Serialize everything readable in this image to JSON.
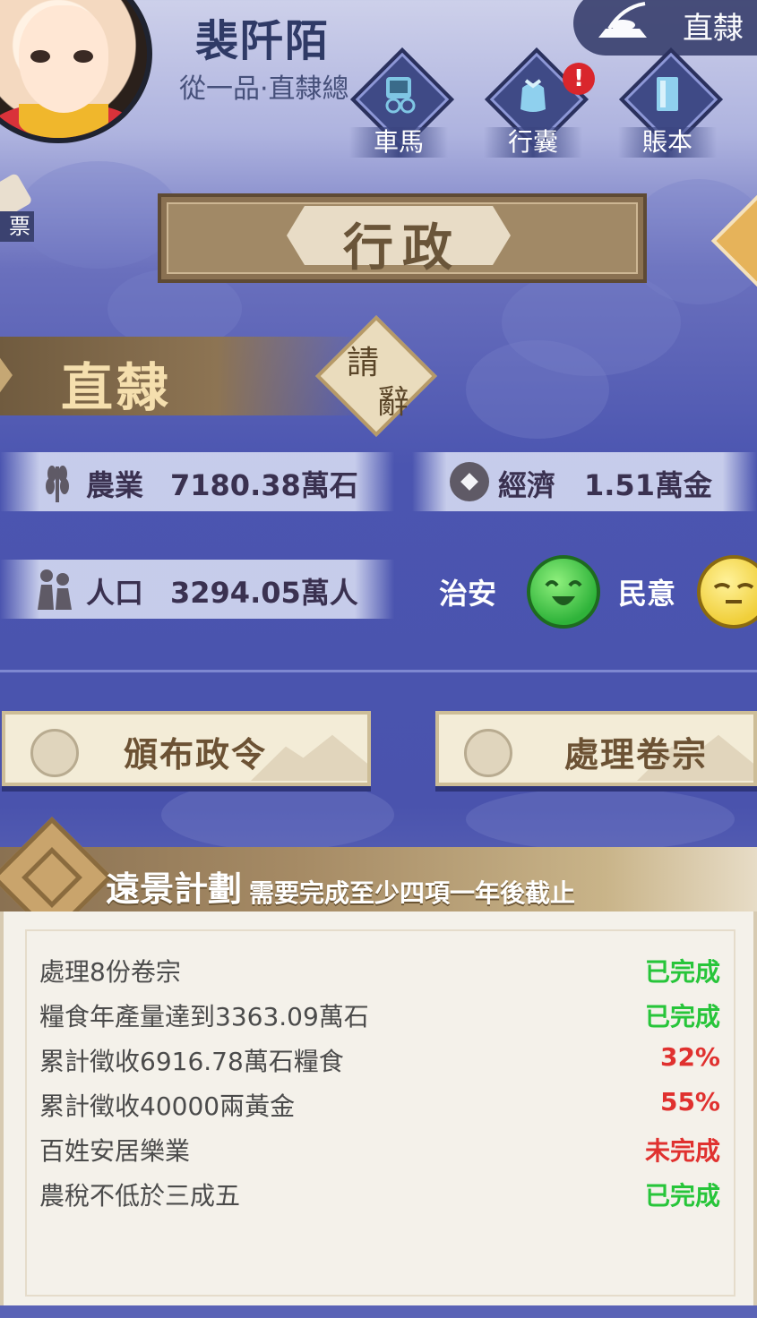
{
  "player": {
    "name": "裴阡陌",
    "title": "從一品·直隸總"
  },
  "region_button": {
    "label": "直隸",
    "icon": "carriage-seal-icon"
  },
  "menu": [
    {
      "label": "車馬",
      "icon": "carriage-icon",
      "badge": ""
    },
    {
      "label": "行囊",
      "icon": "bundle-icon",
      "badge": "!"
    },
    {
      "label": "賬本",
      "icon": "ledger-icon",
      "badge": ""
    }
  ],
  "side_tab": {
    "label": "票"
  },
  "page": {
    "title": "行政"
  },
  "region": {
    "name": "直隸",
    "resign_line1": "請",
    "resign_line2": "辭"
  },
  "stats": {
    "agriculture": {
      "label": "農業",
      "value": "7180.38萬石",
      "icon": "wheat-icon"
    },
    "economy": {
      "label": "經濟",
      "value": "1.51萬金",
      "icon": "coin-icon"
    },
    "population": {
      "label": "人口",
      "value": "3294.05萬人",
      "icon": "people-icon"
    },
    "security": {
      "label": "治安",
      "face": "happy-face-icon"
    },
    "public_opinion": {
      "label": "民意",
      "face": "neutral-face-icon"
    }
  },
  "actions": {
    "issue_decree": "頒布政令",
    "process_files": "處理卷宗"
  },
  "plan": {
    "title": "遠景計劃",
    "note": "需要完成至少四項一年後截止",
    "tasks": [
      {
        "name": "處理8份卷宗",
        "status": "已完成",
        "state": "ok"
      },
      {
        "name": "糧食年產量達到3363.09萬石",
        "status": "已完成",
        "state": "ok"
      },
      {
        "name": "累計徵收6916.78萬石糧食",
        "status": "32%",
        "state": "bad"
      },
      {
        "name": "累計徵收40000兩黃金",
        "status": "55%",
        "state": "bad"
      },
      {
        "name": "百姓安居樂業",
        "status": "未完成",
        "state": "bad"
      },
      {
        "name": "農稅不低於三成五",
        "status": "已完成",
        "state": "ok"
      }
    ]
  },
  "colors": {
    "complete": "#27c53a",
    "incomplete": "#e0312f",
    "banner": "#8a7152",
    "background": "#4b55b0"
  }
}
